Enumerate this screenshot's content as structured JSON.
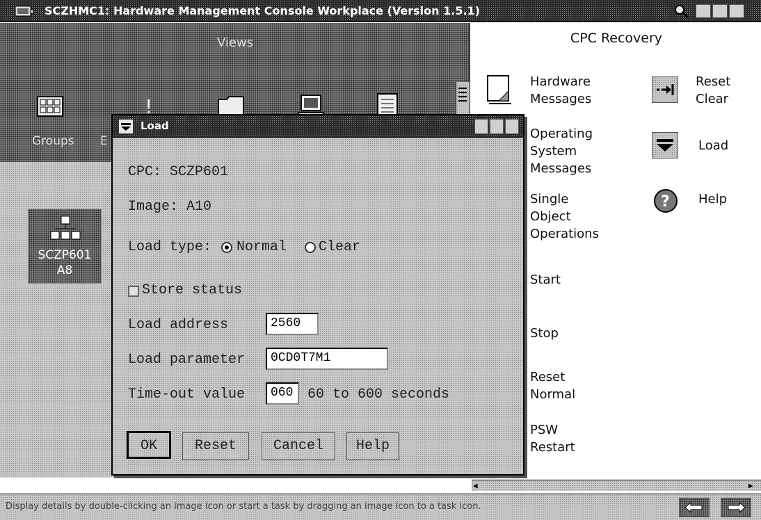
{
  "window": {
    "title": "SCZHMC1: Hardware Management Console Workplace (Version 1.5.1)"
  },
  "views": {
    "label": "Views",
    "groups_label": "Groups",
    "next_label_partial": "E"
  },
  "work_area": {
    "group_icon_line1": "SCZP601",
    "group_icon_line2": "A8"
  },
  "recovery": {
    "title": "CPC Recovery",
    "tasks": {
      "hardware_messages": [
        "Hardware",
        "Messages"
      ],
      "os_messages": [
        "Operating",
        "System",
        "Messages"
      ],
      "single_object": [
        "Single",
        "Object",
        "Operations"
      ],
      "start": "Start",
      "stop": "Stop",
      "reset_normal": [
        "Reset",
        "Normal"
      ],
      "psw_restart": [
        "PSW",
        "Restart"
      ],
      "reset_clear": [
        "Reset",
        "Clear"
      ],
      "load": "Load",
      "help": "Help"
    }
  },
  "dialog": {
    "title": "Load",
    "cpc": "CPC: SCZP601",
    "image": "Image: A10",
    "load_type_label": "Load type:",
    "load_type_normal": "Normal",
    "load_type_clear": "Clear",
    "load_type_selected": "Normal",
    "store_status_label": "Store status",
    "store_status_checked": false,
    "load_address_label": "Load address",
    "load_address_value": "2560",
    "load_parameter_label": "Load parameter",
    "load_parameter_value": "0CD0T7M1",
    "timeout_label": "Time-out value",
    "timeout_value": "060",
    "timeout_range": "60 to 600 seconds",
    "buttons": {
      "ok": "OK",
      "reset": "Reset",
      "cancel": "Cancel",
      "help": "Help"
    }
  },
  "status_bar": {
    "text": "Display details by double-clicking an image icon or start a task by dragging an image icon to a task icon."
  }
}
